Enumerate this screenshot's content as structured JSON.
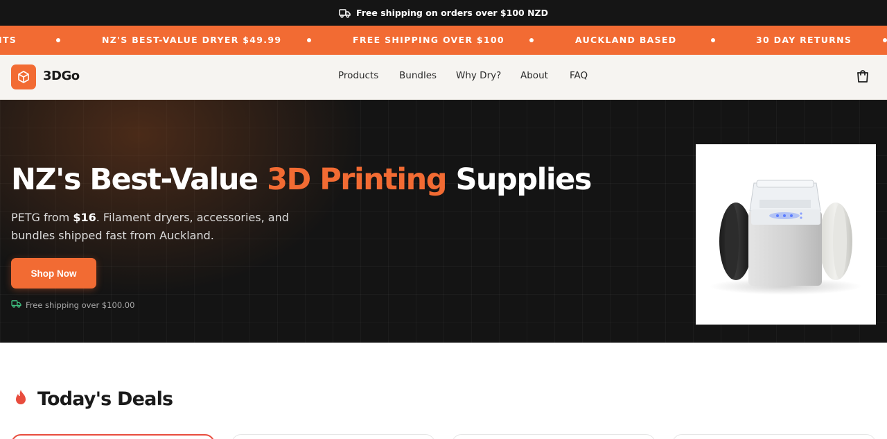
{
  "topbar": {
    "text": "Free shipping on orders over $100 NZD",
    "icon": "truck-icon"
  },
  "marquee": {
    "items": [
      "ITS",
      "NZ'S BEST-VALUE DRYER $49.99",
      "FREE SHIPPING OVER $100",
      "AUCKLAND BASED",
      "30 DAY RETURNS"
    ]
  },
  "header": {
    "brand": "3DGo",
    "nav": [
      "Products",
      "Bundles",
      "Why Dry?",
      "About",
      "FAQ"
    ]
  },
  "hero": {
    "title_part1": "NZ's Best-Value ",
    "title_accent": "3D Printing",
    "title_part2": " Supplies",
    "sub_prefix": "PETG from ",
    "sub_price": "$16",
    "sub_rest": ". Filament dryers, accessories, and bundles shipped fast from Auckland.",
    "cta": "Shop Now",
    "shipping_note": "Free shipping over $100.00"
  },
  "deals": {
    "title": "Today's Deals",
    "icon": "flame-icon"
  },
  "colors": {
    "accent": "#f26b33",
    "dark": "#141414",
    "header_bg": "#f6f4f1",
    "deal_border": "#e84c3d"
  }
}
